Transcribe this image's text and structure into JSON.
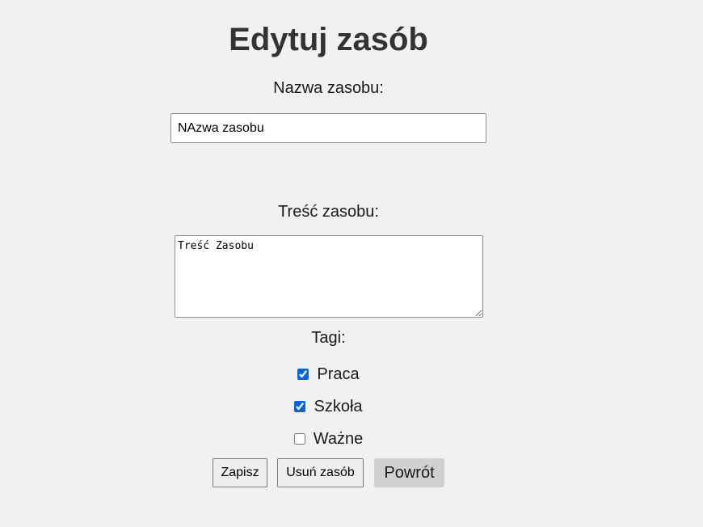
{
  "page": {
    "title": "Edytuj zasób"
  },
  "form": {
    "name_label": "Nazwa zasobu:",
    "name_value": "NAzwa zasobu",
    "content_label": "Treść zasobu:",
    "content_value": "Treść Zasobu",
    "tags_label": "Tagi:",
    "tags": [
      {
        "label": "Praca",
        "checked": true
      },
      {
        "label": "Szkoła",
        "checked": true
      },
      {
        "label": "Ważne",
        "checked": false
      }
    ]
  },
  "actions": {
    "save_label": "Zapisz",
    "delete_label": "Usuń zasób",
    "back_label": "Powrót"
  },
  "colors": {
    "background": "#f1f1f1",
    "title": "#333333",
    "checkbox_accent": "#0a66d8",
    "back_button_bg": "#d0d0d0"
  }
}
